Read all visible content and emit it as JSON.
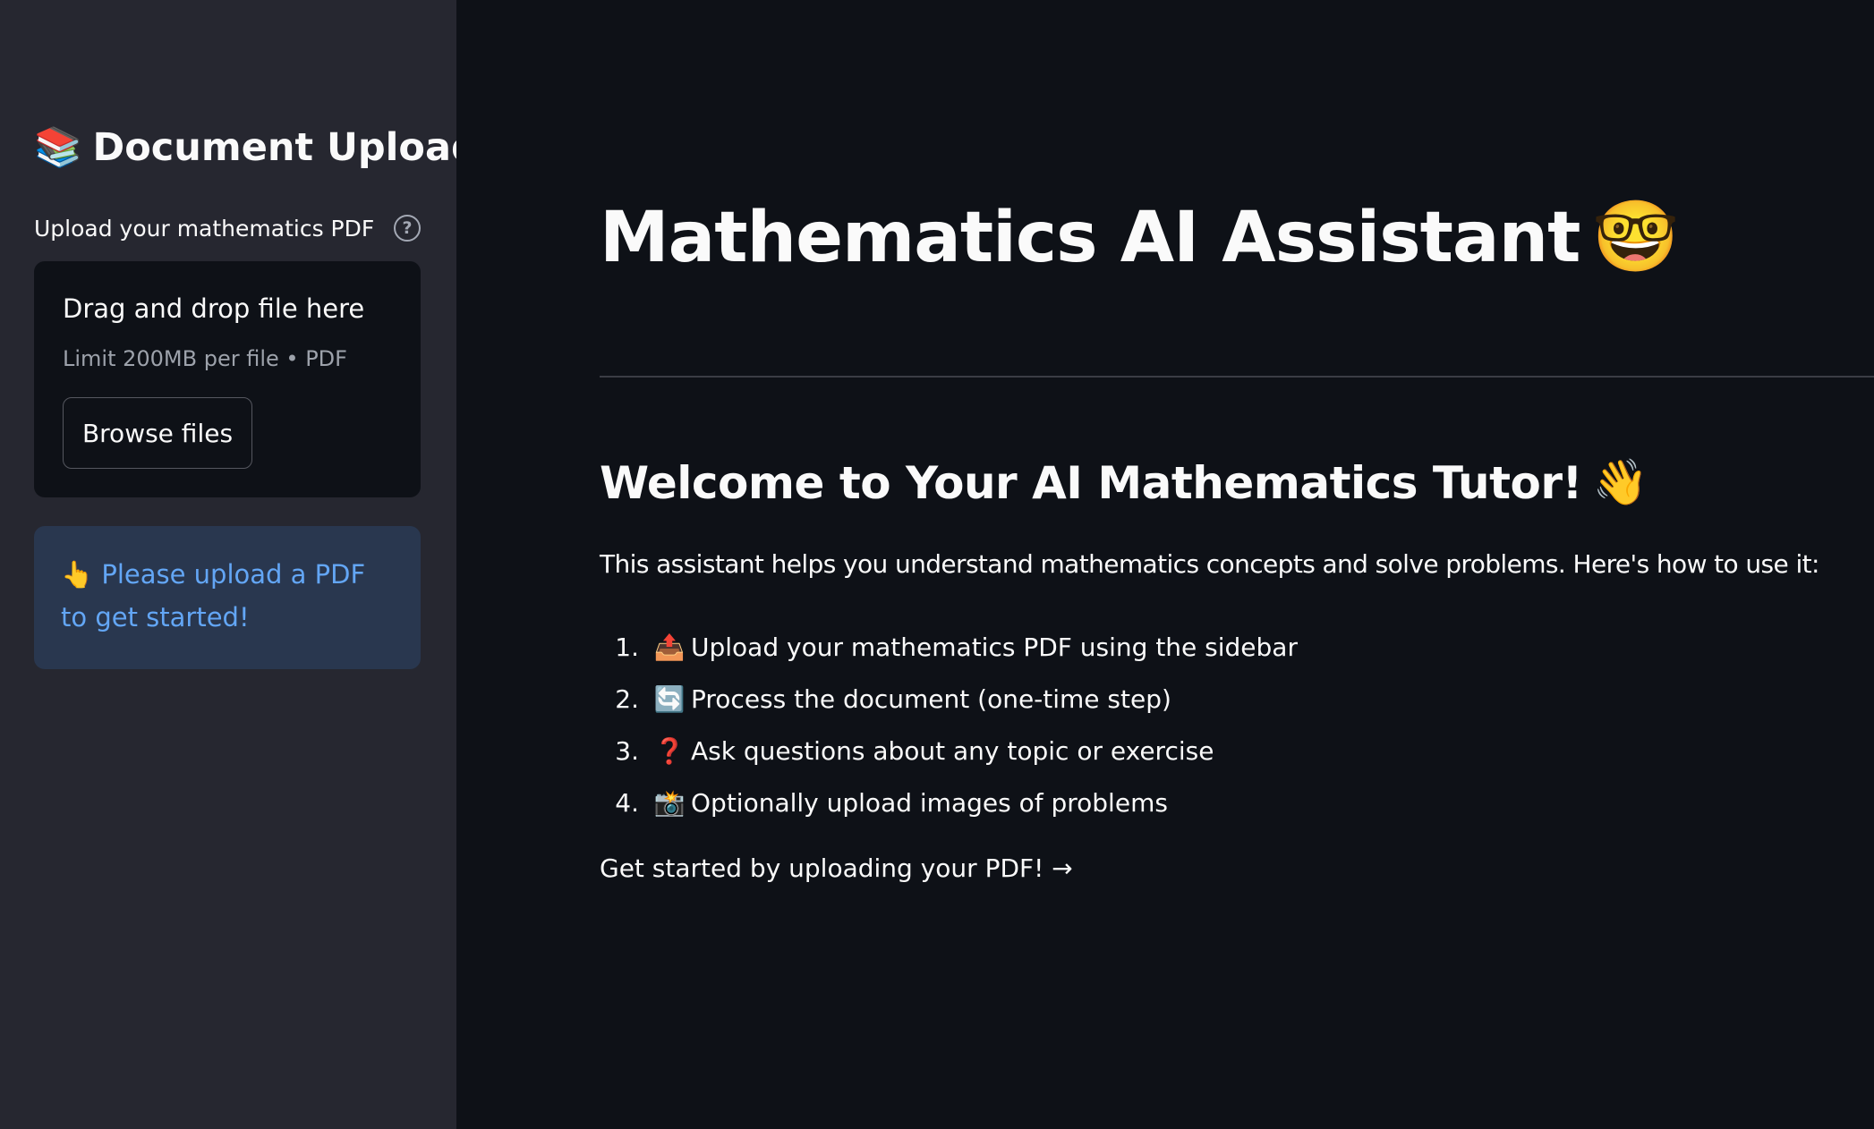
{
  "sidebar": {
    "title": "Document Upload",
    "title_icon": "📚",
    "uploader": {
      "label": "Upload your mathematics PDF",
      "help_icon": "?",
      "dropzone_text": "Drag and drop file here",
      "limit_text": "Limit 200MB per file • PDF",
      "browse_label": "Browse files"
    },
    "info": {
      "icon": "👆",
      "text": "Please upload a PDF to get started!"
    }
  },
  "main": {
    "title": "Mathematics AI Assistant",
    "title_icon": "🤓",
    "welcome_title": "Welcome to Your AI Mathematics Tutor!",
    "welcome_icon": "👋",
    "intro": "This assistant helps you understand mathematics concepts and solve problems. Here's how to use it:",
    "steps": [
      {
        "num": "1.",
        "icon": "📤",
        "text": "Upload your mathematics PDF using the sidebar"
      },
      {
        "num": "2.",
        "icon": "🔄",
        "text": "Process the document (one-time step)"
      },
      {
        "num": "3.",
        "icon": "❓",
        "text": "Ask questions about any topic or exercise"
      },
      {
        "num": "4.",
        "icon": "📸",
        "text": "Optionally upload images of problems"
      }
    ],
    "get_started": "Get started by uploading your PDF! →"
  },
  "colors": {
    "background": "#0e1117",
    "sidebar": "#262730",
    "info_bg": "#29374f",
    "info_text": "#63a6f5",
    "text": "#fafafa",
    "muted_text": "#9da2ab"
  }
}
